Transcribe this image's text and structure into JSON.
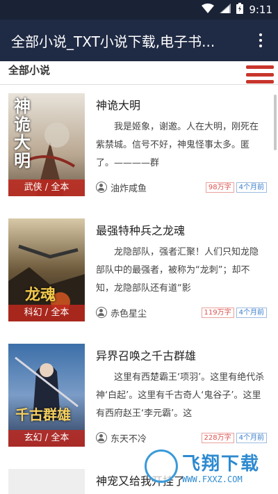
{
  "status_bar": {
    "time": "9:11",
    "icons": [
      "wifi-icon",
      "signal-icon",
      "battery-icon"
    ]
  },
  "app_bar": {
    "title": "全部小说_TXT小说下载,电子书...",
    "menu_icon": "more-vert-icon"
  },
  "section": {
    "label": "全部小说",
    "menu_icon": "hamburger-menu-icon"
  },
  "books": [
    {
      "title": "神诡大明",
      "category": "武侠 / 全本",
      "cover_title": "神诡大明",
      "intro": "我是姬象，谢邀。人在大明，刚死在紫禁城。信号不好，神鬼怪事太多。匿了。————群",
      "author": "油炸咸鱼",
      "words": "98万字",
      "updated": "4个月前"
    },
    {
      "title": "最强特种兵之龙魂",
      "category": "科幻 / 全本",
      "cover_title": "龙魂",
      "intro": "龙隐部队，强者汇聚！人们只知龙隐部队中的最强者，被称为“龙刺”；却不知，龙隐部队还有道“影",
      "author": "赤色星尘",
      "words": "119万字",
      "updated": "4个月前"
    },
    {
      "title": "异界召唤之千古群雄",
      "category": "玄幻 / 全本",
      "cover_title": "千古群雄",
      "intro": "这里有西楚霸王‘项羽’。这里有绝代杀神‘白起’。这里有千古奇人‘鬼谷子’。这里有西府赵王‘李元霸’。这",
      "author": "东天不冷",
      "words": "228万字",
      "updated": "4个月前"
    },
    {
      "title": "神宠又给我开挂了",
      "category": "",
      "cover_title": "",
      "intro": "",
      "author": "",
      "words": "",
      "updated": ""
    }
  ],
  "watermark": {
    "text": "飞翔下载",
    "url": "WWW.FXXZ.COM"
  },
  "colors": {
    "app_bar": "#1f2a44",
    "accent": "#c8352b",
    "badge": "#be281e",
    "tag_time": "#3a7ecb"
  }
}
